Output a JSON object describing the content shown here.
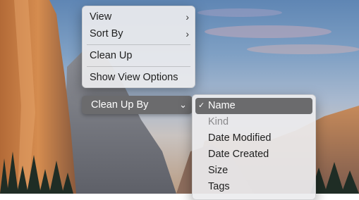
{
  "context_menu": {
    "items": [
      {
        "label": "View",
        "has_submenu": true
      },
      {
        "label": "Sort By",
        "has_submenu": true
      },
      {
        "label": "Clean Up",
        "has_submenu": false
      },
      {
        "label": "Show View Options",
        "has_submenu": false
      }
    ]
  },
  "clean_up_by": {
    "label": "Clean Up By",
    "items": [
      {
        "label": "Name",
        "selected": true,
        "enabled": true
      },
      {
        "label": "Kind",
        "selected": false,
        "enabled": false
      },
      {
        "label": "Date Modified",
        "selected": false,
        "enabled": true
      },
      {
        "label": "Date Created",
        "selected": false,
        "enabled": true
      },
      {
        "label": "Size",
        "selected": false,
        "enabled": true
      },
      {
        "label": "Tags",
        "selected": false,
        "enabled": true
      }
    ]
  },
  "icons": {
    "submenu_arrow": "chevron-right-icon",
    "checkmark": "checkmark-icon"
  },
  "colors": {
    "highlight": "#6b6b6d"
  }
}
